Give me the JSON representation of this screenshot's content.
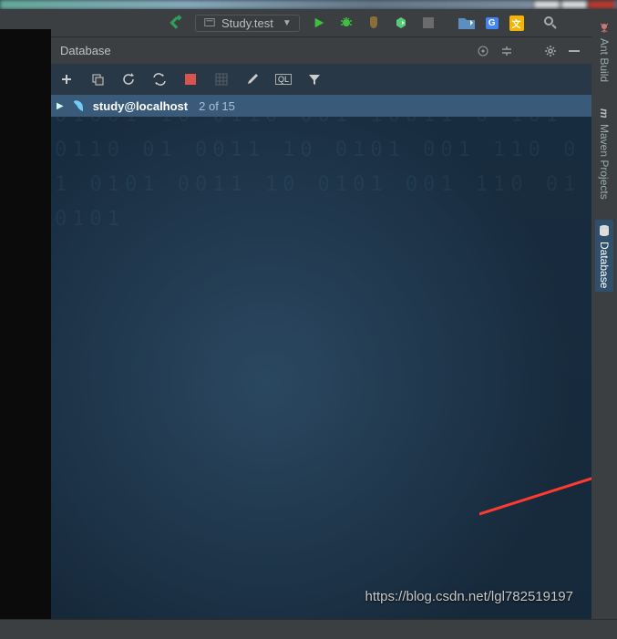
{
  "top": {
    "run_config": "Study.test"
  },
  "panel": {
    "title": "Database"
  },
  "tree": {
    "item": {
      "name": "study@localhost",
      "count": "2 of 15"
    }
  },
  "right_tabs": {
    "ant": "Ant Build",
    "maven": "Maven Projects",
    "database": "Database"
  },
  "db_toolbar": {
    "ql_label": "QL"
  },
  "watermark": "https://blog.csdn.net/lgl782519197"
}
